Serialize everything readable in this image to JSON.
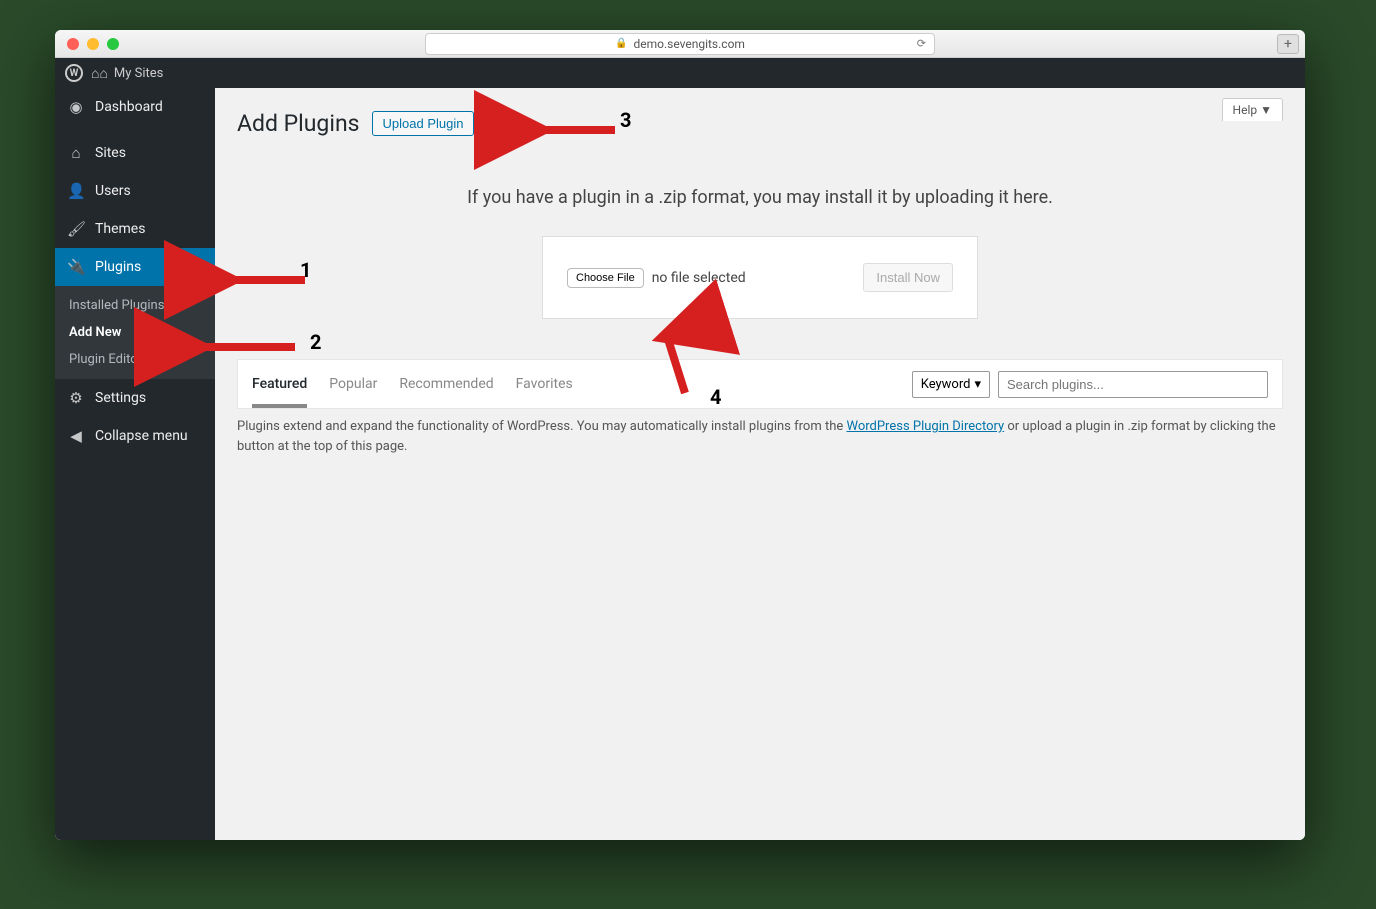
{
  "browser": {
    "url": "demo.sevengits.com"
  },
  "toolbar": {
    "mysites_label": "My Sites"
  },
  "sidebar": {
    "items": [
      {
        "label": "Dashboard",
        "icon": "dashboard"
      },
      {
        "label": "Sites",
        "icon": "sites"
      },
      {
        "label": "Users",
        "icon": "users"
      },
      {
        "label": "Themes",
        "icon": "themes"
      },
      {
        "label": "Plugins",
        "icon": "plugins",
        "active": true
      },
      {
        "label": "Settings",
        "icon": "settings"
      },
      {
        "label": "Collapse menu",
        "icon": "collapse"
      }
    ],
    "submenu": [
      {
        "label": "Installed Plugins"
      },
      {
        "label": "Add New",
        "current": true
      },
      {
        "label": "Plugin Editor"
      }
    ]
  },
  "help_label": "Help",
  "page": {
    "title": "Add Plugins",
    "upload_button": "Upload Plugin",
    "upload_hint": "If you have a plugin in a .zip format, you may install it by uploading it here.",
    "choose_file": "Choose File",
    "file_status": "no file selected",
    "install_now": "Install Now"
  },
  "filters": {
    "tabs": [
      "Featured",
      "Popular",
      "Recommended",
      "Favorites"
    ],
    "active": "Featured",
    "keyword_label": "Keyword",
    "search_placeholder": "Search plugins..."
  },
  "description": {
    "prefix": "Plugins extend and expand the functionality of WordPress. You may automatically install plugins from the ",
    "link_text": "WordPress Plugin Directory",
    "suffix": " or upload a plugin in .zip format by clicking the button at the top of this page."
  },
  "annotations": {
    "a1": "1",
    "a2": "2",
    "a3": "3",
    "a4": "4"
  }
}
